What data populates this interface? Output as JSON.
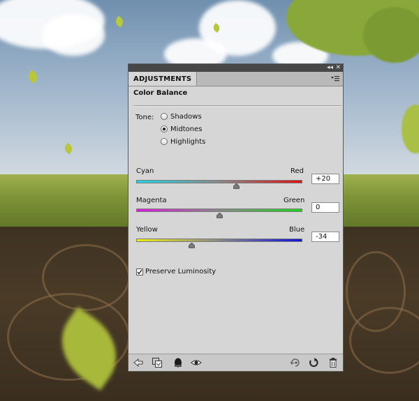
{
  "panel": {
    "tab_label": "ADJUSTMENTS",
    "title_controls": {
      "collapse": "◂◂",
      "close": "✕"
    },
    "heading": "Color Balance"
  },
  "tone": {
    "label": "Tone:",
    "options": [
      {
        "label": "Shadows",
        "selected": false
      },
      {
        "label": "Midtones",
        "selected": true
      },
      {
        "label": "Highlights",
        "selected": false
      }
    ]
  },
  "sliders": [
    {
      "left_label": "Cyan",
      "right_label": "Red",
      "value": "+20",
      "level": 20,
      "min": -100,
      "max": 100,
      "left_color": "#1cd8e8",
      "right_color": "#e01010"
    },
    {
      "left_label": "Magenta",
      "right_label": "Green",
      "value": "0",
      "level": 0,
      "min": -100,
      "max": 100,
      "left_color": "#e018e0",
      "right_color": "#18d818"
    },
    {
      "left_label": "Yellow",
      "right_label": "Blue",
      "value": "-34",
      "level": -34,
      "min": -100,
      "max": 100,
      "left_color": "#eeee10",
      "right_color": "#1010e0"
    }
  ],
  "preserve_luminosity": {
    "label": "Preserve Luminosity",
    "checked": true
  },
  "toolbar_icons": [
    "back-arrow-icon",
    "clip-to-layer-icon",
    "layer-mask-icon",
    "visibility-eye-icon",
    "view-previous-state-icon",
    "reset-icon",
    "trash-icon"
  ]
}
